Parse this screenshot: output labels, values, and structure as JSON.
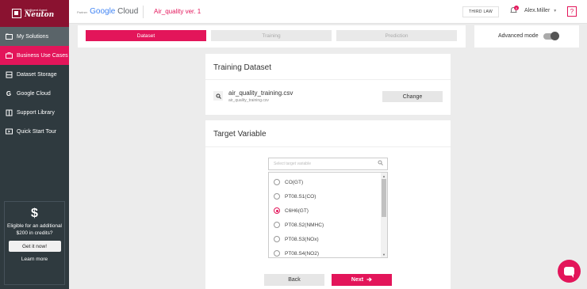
{
  "sidebar": {
    "logo_small": "Intelligent Agent",
    "logo_big": "Neuton",
    "items": [
      {
        "label": "My Solutions",
        "icon": "folder-icon",
        "state": "selected"
      },
      {
        "label": "Business Use Cases",
        "icon": "briefcase-icon",
        "state": "active"
      },
      {
        "label": "Dataset Storage",
        "icon": "database-icon",
        "state": ""
      },
      {
        "label": "Google Cloud",
        "icon": "google-icon",
        "state": ""
      },
      {
        "label": "Support Library",
        "icon": "book-icon",
        "state": ""
      },
      {
        "label": "Quick Start Tour",
        "icon": "tour-icon",
        "state": ""
      }
    ],
    "promo": {
      "symbol": "$",
      "text": "Eligible for an additional $200 in credits?",
      "button": "Get it now!",
      "link": "Learn more"
    }
  },
  "topbar": {
    "partner_small": "Partner",
    "google": "Google",
    "cloud": "Cloud",
    "project": "Air_quality ver. 1",
    "third_law": "THIRD LAW",
    "notifications": "0",
    "user": "Alex.Miller",
    "help": "?"
  },
  "steps": [
    {
      "label": "Dataset",
      "state": "done"
    },
    {
      "label": "Training",
      "state": "todo"
    },
    {
      "label": "Prediction",
      "state": "todo"
    }
  ],
  "advanced_mode": {
    "label": "Advanced mode",
    "on": false
  },
  "training_dataset": {
    "title": "Training Dataset",
    "file_name": "air_quality_training.csv",
    "file_sub": "air_quality_training.csv",
    "change": "Change"
  },
  "target_variable": {
    "title": "Target Variable",
    "search_placeholder": "Select target variable",
    "options": [
      {
        "label": "CO(GT)",
        "selected": false
      },
      {
        "label": "PT08.S1(CO)",
        "selected": false
      },
      {
        "label": "C6H6(GT)",
        "selected": true
      },
      {
        "label": "PT08.S2(NMHC)",
        "selected": false
      },
      {
        "label": "PT08.S3(NOx)",
        "selected": false
      },
      {
        "label": "PT08.S4(NO2)",
        "selected": false
      }
    ],
    "back": "Back",
    "next": "Next"
  },
  "colors": {
    "accent": "#e3155a",
    "sidebar": "#2f3a3f",
    "logo": "#8a1230"
  }
}
